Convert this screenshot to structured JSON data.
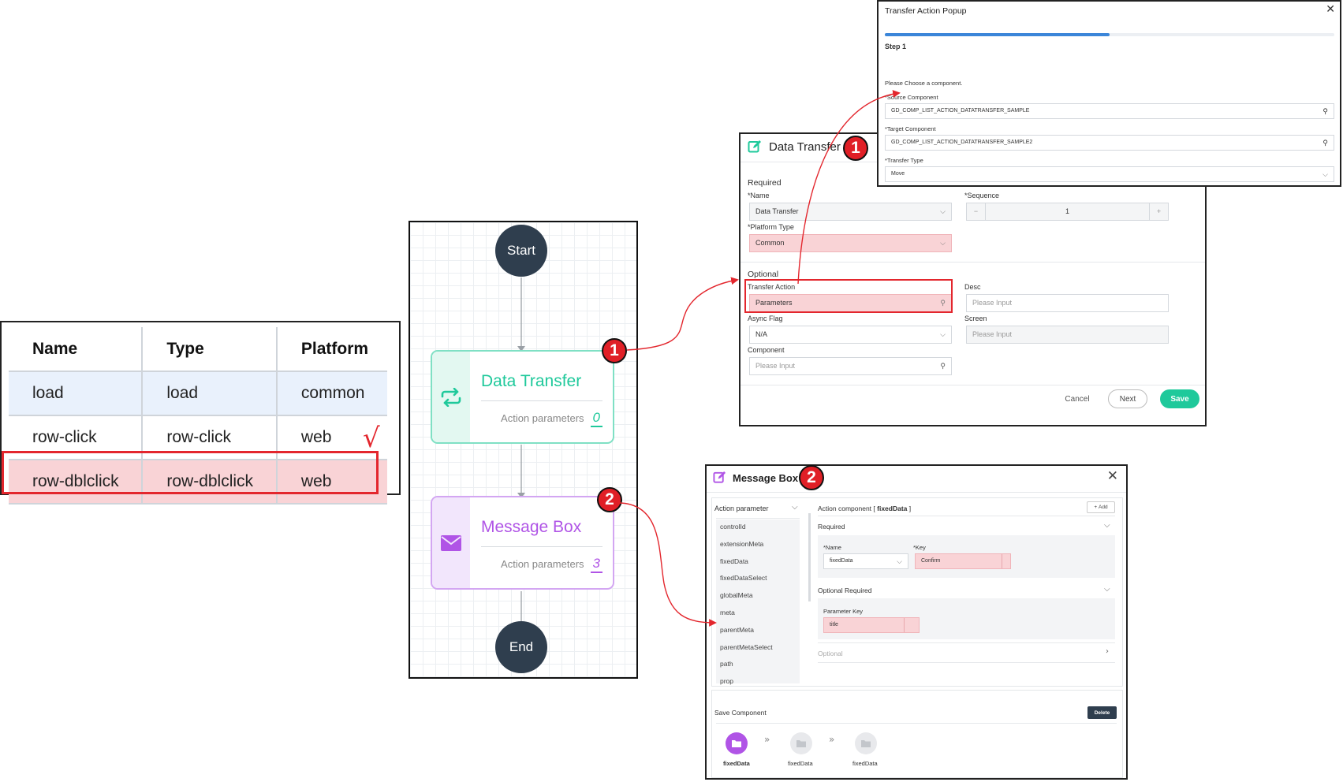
{
  "table": {
    "headers": [
      "Name",
      "Type",
      "Platform"
    ],
    "rows": [
      [
        "load",
        "load",
        "common"
      ],
      [
        "row-click",
        "row-click",
        "web"
      ],
      [
        "row-dblclick",
        "row-dblclick",
        "web"
      ]
    ],
    "check": "√"
  },
  "flow": {
    "start": "Start",
    "end": "End",
    "node1": {
      "title": "Data Transfer",
      "param_label": "Action parameters",
      "param_count": "0",
      "badge": "1",
      "color": "#1fc99b"
    },
    "node2": {
      "title": "Message Box",
      "param_label": "Action parameters",
      "param_count": "3",
      "badge": "2",
      "color": "#b054e6"
    }
  },
  "data_transfer": {
    "title": "Data Transfer",
    "badge": "1",
    "required": "Required",
    "name_label": "*Name",
    "name_value": "Data Transfer",
    "sequence_label": "*Sequence",
    "sequence_value": "1",
    "platform_label": "*Platform Type",
    "platform_value": "Common",
    "optional": "Optional",
    "transfer_label": "Transfer Action",
    "transfer_value": "Parameters",
    "desc_label": "Desc",
    "desc_placeholder": "Please Input",
    "async_label": "Async Flag",
    "async_value": "N/A",
    "screen_label": "Screen",
    "screen_placeholder": "Please Input",
    "component_label": "Component",
    "component_placeholder": "Please Input",
    "cancel": "Cancel",
    "next": "Next",
    "save": "Save"
  },
  "popup": {
    "title": "Transfer Action Popup",
    "step": "Step 1",
    "progress": 0.5,
    "instruction": "Please Choose a component.",
    "source_label": "*Source Component",
    "source_value": "GD_COMP_LIST_ACTION_DATATRANSFER_SAMPLE",
    "target_label": "*Target Component",
    "target_value": "GD_COMP_LIST_ACTION_DATATRANSFER_SAMPLE2",
    "type_label": "*Transfer Type",
    "type_value": "Move"
  },
  "message_box": {
    "title": "Message Box",
    "badge": "2",
    "param_header": "Action parameter",
    "params": [
      "controlId",
      "extensionMeta",
      "fixedData",
      "fixedDataSelect",
      "globalMeta",
      "meta",
      "parentMeta",
      "parentMetaSelect",
      "path",
      "prop"
    ],
    "component_prefix": "Action component [ ",
    "component_name": "fixedData",
    "component_suffix": " ]",
    "add": "Add",
    "required": "Required",
    "name_label": "*Name",
    "name_value": "fixedData",
    "key_label": "*Key",
    "key_value": "Confirm",
    "optional_required": "Optional Required",
    "param_key_label": "Parameter Key",
    "param_key_value": "title",
    "optional": "Optional",
    "save_component": "Save Component",
    "delete": "Delete",
    "steps": [
      "fixedData",
      "fixedData",
      "fixedData"
    ],
    "accent": "#b054e6"
  }
}
